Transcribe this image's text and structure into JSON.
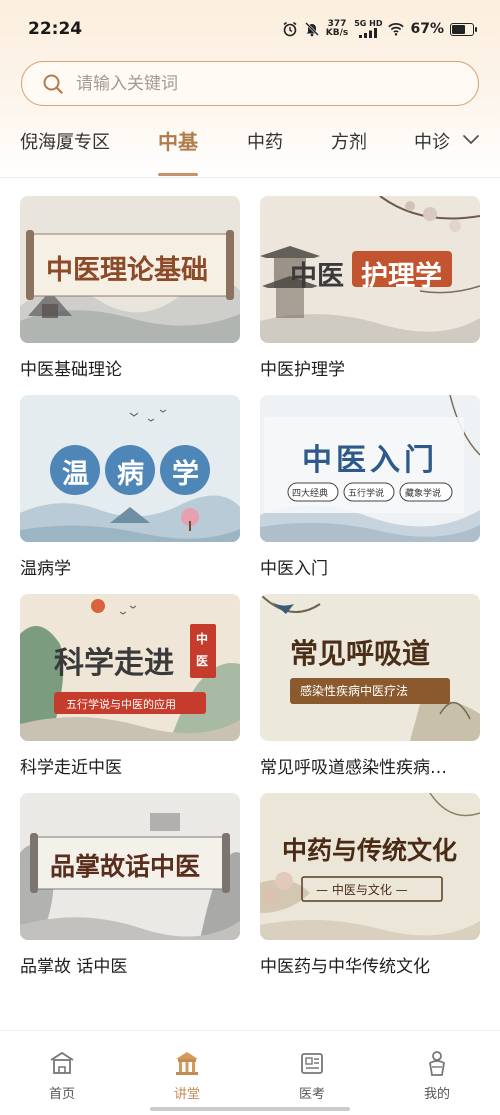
{
  "status_bar": {
    "time": "22:24",
    "net_speed_value": "377",
    "net_speed_unit": "KB/s",
    "net_type": "5G HD",
    "battery_percent": "67%",
    "battery_level": 0.67
  },
  "search": {
    "placeholder": "请输入关键词"
  },
  "tabs": [
    {
      "label": "倪海厦专区",
      "active": false
    },
    {
      "label": "中基",
      "active": true
    },
    {
      "label": "中药",
      "active": false
    },
    {
      "label": "方剂",
      "active": false
    },
    {
      "label": "中诊",
      "active": false
    }
  ],
  "courses": [
    {
      "title": "中医基础理论",
      "thumb_text": "中医理论基础"
    },
    {
      "title": "中医护理学",
      "thumb_text_a": "中医",
      "thumb_text_b": "护理学"
    },
    {
      "title": "温病学",
      "thumb_chars": [
        "温",
        "病",
        "学"
      ]
    },
    {
      "title": "中医入门",
      "thumb_text": "中医入门",
      "thumb_tags": [
        "四大经典",
        "五行学说",
        "藏象学说"
      ]
    },
    {
      "title": "科学走近中医",
      "thumb_text": "科学走进",
      "thumb_seal": "中医",
      "thumb_sub": "五行学说与中医的应用"
    },
    {
      "title": "常见呼吸道感染性疾病…",
      "thumb_text": "常见呼吸道",
      "thumb_sub": "感染性疾病中医疗法"
    },
    {
      "title": "品掌故 话中医",
      "thumb_text": "品掌故话中医"
    },
    {
      "title": "中医药与中华传统文化",
      "thumb_text": "中药与传统文化",
      "thumb_sub": "— 中医与文化 —"
    }
  ],
  "bottom_nav": [
    {
      "label": "首页",
      "icon": "home-icon",
      "active": false
    },
    {
      "label": "讲堂",
      "icon": "lecture-hall-icon",
      "active": true
    },
    {
      "label": "医考",
      "icon": "exam-icon",
      "active": false
    },
    {
      "label": "我的",
      "icon": "profile-icon",
      "active": false
    }
  ],
  "colors": {
    "accent": "#c48c54",
    "tab_active": "#b07c4b",
    "search_border": "#d9a473"
  }
}
